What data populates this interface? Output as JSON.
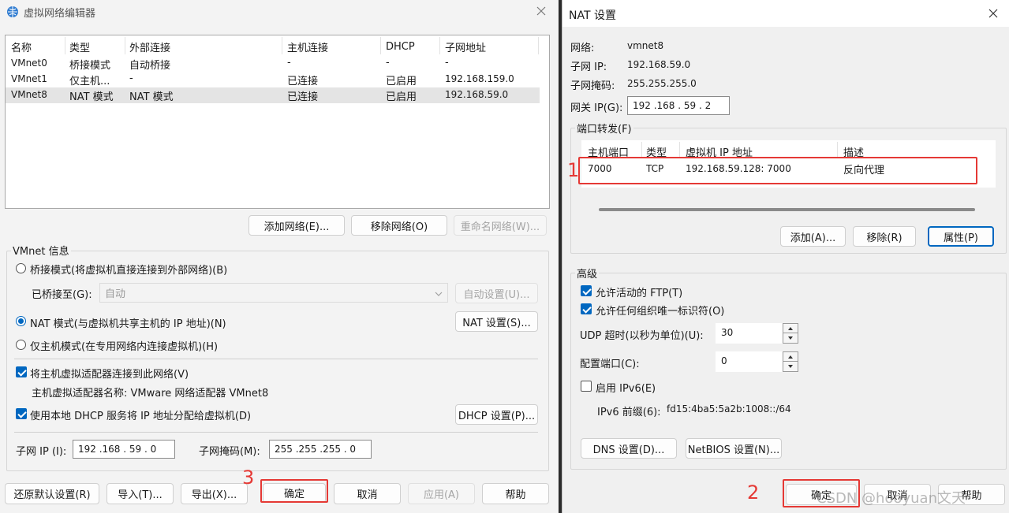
{
  "left": {
    "title": "虚拟网络编辑器",
    "table": {
      "headers": [
        "名称",
        "类型",
        "外部连接",
        "主机连接",
        "DHCP",
        "子网地址"
      ],
      "rows": [
        [
          "VMnet0",
          "桥接模式",
          "自动桥接",
          "-",
          "-",
          "-"
        ],
        [
          "VMnet1",
          "仅主机...",
          "-",
          "已连接",
          "已启用",
          "192.168.159.0"
        ],
        [
          "VMnet8",
          "NAT 模式",
          "NAT 模式",
          "已连接",
          "已启用",
          "192.168.59.0"
        ]
      ]
    },
    "add_network": "添加网络(E)...",
    "remove_network": "移除网络(O)",
    "rename_network": "重命名网络(W)...",
    "vmnet_info": "VMnet 信息",
    "bridge_mode": "桥接模式(将虚拟机直接连接到外部网络)(B)",
    "bridged_to_label": "已桥接至(G):",
    "bridged_to_value": "自动",
    "auto_settings": "自动设置(U)...",
    "nat_mode": "NAT 模式(与虚拟机共享主机的 IP 地址)(N)",
    "nat_settings": "NAT 设置(S)...",
    "host_only_mode": "仅主机模式(在专用网络内连接虚拟机)(H)",
    "connect_adapter": "将主机虚拟适配器连接到此网络(V)",
    "adapter_name": "主机虚拟适配器名称: VMware 网络适配器 VMnet8",
    "use_dhcp": "使用本地 DHCP 服务将 IP 地址分配给虚拟机(D)",
    "dhcp_settings": "DHCP 设置(P)...",
    "subnet_ip_label": "子网 IP (I):",
    "subnet_ip": "192 .168 . 59 .  0",
    "subnet_mask_label": "子网掩码(M):",
    "subnet_mask": "255 .255 .255 .  0",
    "restore_defaults": "还原默认设置(R)",
    "import": "导入(T)...",
    "export": "导出(X)...",
    "ok": "确定",
    "cancel": "取消",
    "apply": "应用(A)",
    "help": "帮助"
  },
  "right": {
    "title": "NAT 设置",
    "network_label": "网络:",
    "network_value": "vmnet8",
    "subnet_ip_label": "子网 IP:",
    "subnet_ip_value": "192.168.59.0",
    "subnet_mask_label": "子网掩码:",
    "subnet_mask_value": "255.255.255.0",
    "gateway_label": "网关 IP(G):",
    "gateway_value": "192 .168 . 59 .  2",
    "port_forwarding": "端口转发(F)",
    "pf_headers": [
      "主机端口",
      "类型",
      "虚拟机 IP 地址",
      "描述"
    ],
    "pf_rows": [
      [
        "7000",
        "TCP",
        "192.168.59.128: 7000",
        "反向代理"
      ]
    ],
    "add": "添加(A)...",
    "remove": "移除(R)",
    "properties": "属性(P)",
    "advanced": "高级",
    "allow_ftp": "允许活动的 FTP(T)",
    "allow_oui": "允许任何组织唯一标识符(O)",
    "udp_timeout_label": "UDP 超时(以秒为单位)(U):",
    "udp_timeout_value": "30",
    "config_port_label": "配置端口(C):",
    "config_port_value": "0",
    "enable_ipv6": "启用 IPv6(E)",
    "ipv6_prefix_label": "IPv6 前缀(6):",
    "ipv6_prefix_value": "fd15:4ba5:5a2b:1008::/64",
    "dns_settings": "DNS 设置(D)...",
    "netbios_settings": "NetBIOS 设置(N)...",
    "ok": "确定",
    "cancel": "取消",
    "help": "帮助"
  },
  "annotations": {
    "a1": "1",
    "a2": "2",
    "a3": "3"
  },
  "watermark": "CSDN @hooyuan文天",
  "colors": {
    "accent": "#0067c0",
    "highlight": "#e53935"
  }
}
